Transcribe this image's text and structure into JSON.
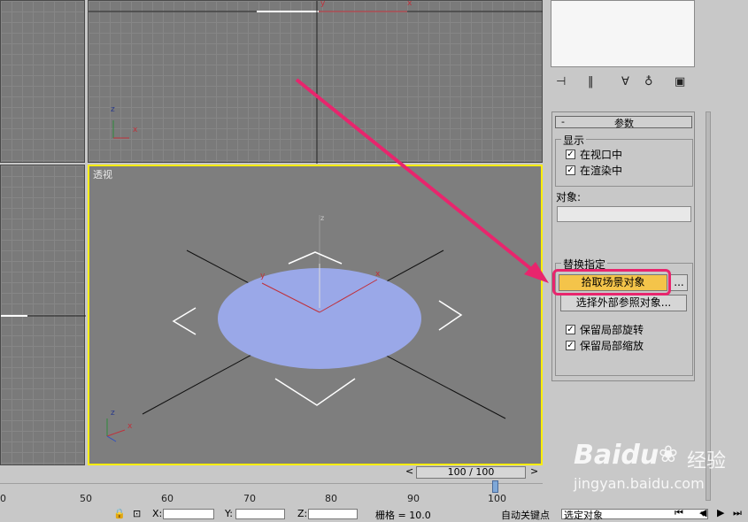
{
  "viewports": {
    "perspective_label": "透视",
    "axis_x": "x",
    "axis_y": "y",
    "axis_z": "z"
  },
  "panel": {
    "rollout_title": "参数",
    "rollout_collapse": "-",
    "display_group": "显示",
    "in_viewport": "在视口中",
    "in_viewport_checked": true,
    "in_render": "在渲染中",
    "in_render_checked": true,
    "object_label": "对象:",
    "object_value": "",
    "replace_group": "替换指定",
    "pick_scene_object": "拾取场景对象",
    "pick_more": "...",
    "select_xref_object": "选择外部参照对象...",
    "keep_local_rotation": "保留局部旋转",
    "keep_local_rotation_checked": true,
    "keep_local_scale": "保留局部缩放",
    "keep_local_scale_checked": true
  },
  "timeline": {
    "frame_display": "100 / 100",
    "ticks": [
      "0",
      "50",
      "60",
      "70",
      "80",
      "90",
      "100"
    ],
    "current_frame": 100
  },
  "status": {
    "x_label": "X:",
    "y_label": "Y:",
    "z_label": "Z:",
    "grid_text": "栅格 = 10.0",
    "auto_key": "自动关键点",
    "selection_dropdown": "选定对象"
  },
  "watermark": {
    "brand": "Baidu",
    "brand_cn": "经验",
    "url": "jingyan.baidu.com"
  },
  "colors": {
    "highlight": "#e8256d",
    "active_viewport_border": "#ffee00",
    "pick_button": "#f4c44a",
    "ellipse": "#9aa8e8"
  }
}
